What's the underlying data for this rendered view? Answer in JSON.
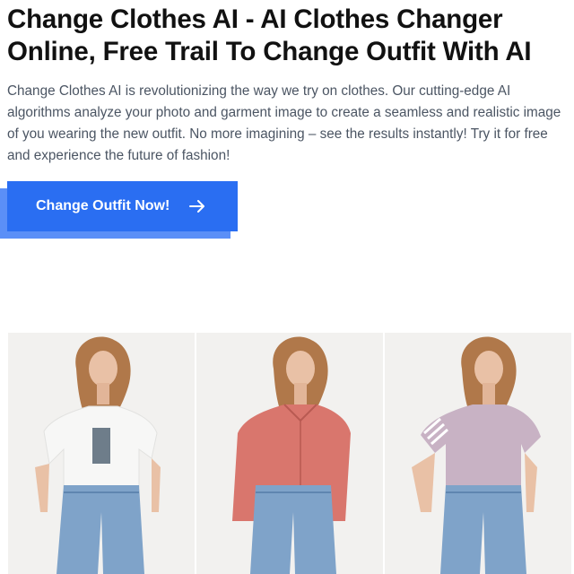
{
  "hero": {
    "title": "Change Clothes AI - AI Clothes Changer Online, Free Trail To Change Outfit With AI",
    "description": "Change Clothes AI is revolutionizing the way we try on clothes. Our cutting-edge AI algorithms analyze your photo and garment image to create a seamless and realistic image of you wearing the new outfit. No more imagining – see the results instantly! Try it for free and experience the future of fashion!",
    "cta_label": "Change Outfit Now!",
    "cta_icon": "arrow-right-icon"
  },
  "gallery": {
    "photos": [
      {
        "name": "model-white-graphic-tee-photo",
        "top_color": "#f7f7f6"
      },
      {
        "name": "model-red-plaid-shirt-photo",
        "top_color": "#d9766d"
      },
      {
        "name": "model-lilac-striped-tee-photo",
        "top_color": "#c8b2c4"
      }
    ]
  },
  "colors": {
    "accent": "#2a6ef2",
    "accent_shadow": "#5b8ff7",
    "title": "#111111",
    "body_text": "#4b5563",
    "jeans": "#7fa3c9",
    "hair": "#b0784a",
    "skin": "#e9c1a6"
  }
}
